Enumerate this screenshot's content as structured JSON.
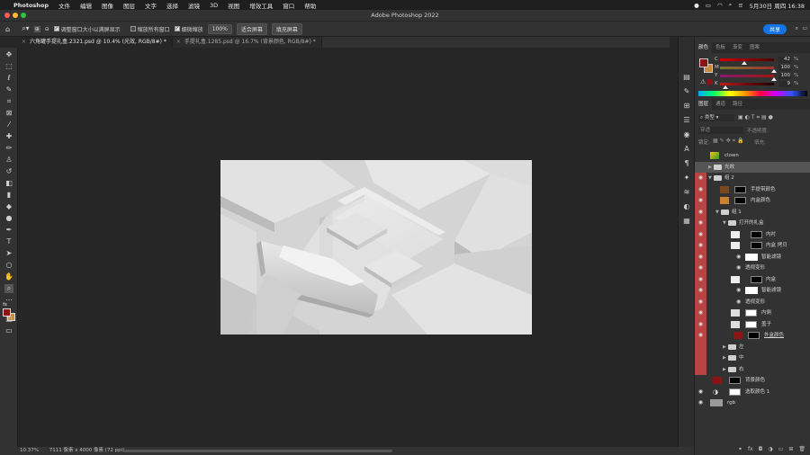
{
  "menubar": {
    "app": "Photoshop",
    "items": [
      "文件",
      "编辑",
      "图像",
      "图层",
      "文字",
      "选择",
      "滤镜",
      "3D",
      "视图",
      "增效工具",
      "窗口",
      "帮助"
    ],
    "clock": "5月30日 周四 16:38"
  },
  "window": {
    "title": "Adobe Photoshop 2022"
  },
  "options": {
    "resize_windows": "调整窗口大小以满屏显示",
    "zoom_all": "缩放所有窗口",
    "scrubby_zoom": "细微缩放",
    "zoom_value": "100%",
    "fit_screen": "适合屏幕",
    "fill_screen": "填充屏幕",
    "share": "共享"
  },
  "tabs": [
    {
      "label": "六角罐手提礼盒.2321.psd @ 10.4% (光效, RGB/8#) *"
    },
    {
      "label": "手提礼盒.1285.psd @ 16.7% (背景颜色, RGB/8#) *"
    }
  ],
  "status": {
    "zoom": "10.37%",
    "size": "7111 像素 x 4000 像素 (72 ppi)"
  },
  "colorpanel": {
    "tabs": [
      "颜色",
      "色板",
      "渐变",
      "图案"
    ],
    "channels": [
      {
        "label": "C",
        "value": "42"
      },
      {
        "label": "M",
        "value": "100"
      },
      {
        "label": "Y",
        "value": "100"
      },
      {
        "label": "K",
        "value": "9"
      }
    ],
    "pct": "%",
    "fg_color": "#8b1414",
    "bg_color": "#c98a3a"
  },
  "layerpanel": {
    "tabs": [
      "图层",
      "通道",
      "路径"
    ],
    "kind_label": "类型",
    "blend_mode": "穿透",
    "opacity_label": "不透明度:",
    "lock_label": "锁定:",
    "fill_label": "填充:",
    "layers": [
      {
        "name": "clown"
      },
      {
        "name": "光效"
      },
      {
        "name": "组 2"
      },
      {
        "name": "手提带颜色"
      },
      {
        "name": "内盒颜色"
      },
      {
        "name": "组 1"
      },
      {
        "name": "打开的礼盒"
      },
      {
        "name": "内衬"
      },
      {
        "name": "内盒 拷贝"
      },
      {
        "name": "智能滤镜"
      },
      {
        "name": "透视变形"
      },
      {
        "name": "内盒"
      },
      {
        "name": "智能滤镜"
      },
      {
        "name": "透视变形"
      },
      {
        "name": "内侧"
      },
      {
        "name": "盖子"
      },
      {
        "name": "外盒颜色"
      },
      {
        "name": "左"
      },
      {
        "name": "中"
      },
      {
        "name": "右"
      },
      {
        "name": "背景颜色"
      },
      {
        "name": "选取颜色 1"
      },
      {
        "name": "rgb"
      }
    ]
  }
}
